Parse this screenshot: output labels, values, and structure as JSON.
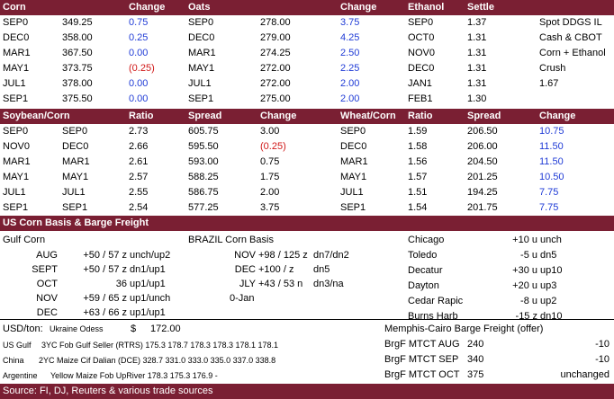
{
  "sec1": {
    "headers": [
      "Corn",
      "Change",
      "Oats",
      "Change",
      "Ethanol",
      "Settle"
    ],
    "rows": [
      {
        "c1": "SEP0",
        "c2": "349.25",
        "c3": "0.75",
        "c3c": "blue",
        "c4": "SEP0",
        "c5": "278.00",
        "c6": "3.75",
        "c6c": "blue",
        "c7": "SEP0",
        "c8": "1.37",
        "c9": "Spot DDGS IL"
      },
      {
        "c1": "DEC0",
        "c2": "358.00",
        "c3": "0.25",
        "c3c": "blue",
        "c4": "DEC0",
        "c5": "279.00",
        "c6": "4.25",
        "c6c": "blue",
        "c7": "OCT0",
        "c8": "1.31",
        "c9": "Cash & CBOT"
      },
      {
        "c1": "MAR1",
        "c2": "367.50",
        "c3": "0.00",
        "c3c": "blue",
        "c4": "MAR1",
        "c5": "274.25",
        "c6": "2.50",
        "c6c": "blue",
        "c7": "NOV0",
        "c8": "1.31",
        "c9": "Corn + Ethanol"
      },
      {
        "c1": "MAY1",
        "c2": "373.75",
        "c3": "(0.25)",
        "c3c": "red",
        "c4": "MAY1",
        "c5": "272.00",
        "c6": "2.25",
        "c6c": "blue",
        "c7": "DEC0",
        "c8": "1.31",
        "c9": "Crush"
      },
      {
        "c1": "JUL1",
        "c2": "378.00",
        "c3": "0.00",
        "c3c": "blue",
        "c4": "JUL1",
        "c5": "272.00",
        "c6": "2.00",
        "c6c": "blue",
        "c7": "JAN1",
        "c8": "1.31",
        "c9": "1.67"
      },
      {
        "c1": "SEP1",
        "c2": "375.50",
        "c3": "0.00",
        "c3c": "blue",
        "c4": "SEP1",
        "c5": "275.00",
        "c6": "2.00",
        "c6c": "blue",
        "c7": "FEB1",
        "c8": "1.30",
        "c9": ""
      }
    ]
  },
  "sec2": {
    "headers": [
      "Soybean/Corn",
      "Ratio",
      "Spread",
      "Change",
      "Wheat/Corn",
      "Ratio",
      "Spread",
      "Change"
    ],
    "rows": [
      {
        "c1": "SEP0",
        "c2": "SEP0",
        "c3": "2.73",
        "c4": "605.75",
        "c5": "3.00",
        "c5c": "black",
        "c6": "SEP0",
        "c7": "1.59",
        "c8": "206.50",
        "c9": "10.75"
      },
      {
        "c1": "NOV0",
        "c2": "DEC0",
        "c3": "2.66",
        "c4": "595.50",
        "c5": "(0.25)",
        "c5c": "red",
        "c6": "DEC0",
        "c7": "1.58",
        "c8": "206.00",
        "c9": "11.50"
      },
      {
        "c1": "MAR1",
        "c2": "MAR1",
        "c3": "2.61",
        "c4": "593.00",
        "c5": "0.75",
        "c5c": "black",
        "c6": "MAR1",
        "c7": "1.56",
        "c8": "204.50",
        "c9": "11.50"
      },
      {
        "c1": "MAY1",
        "c2": "MAY1",
        "c3": "2.57",
        "c4": "588.25",
        "c5": "1.75",
        "c5c": "black",
        "c6": "MAY1",
        "c7": "1.57",
        "c8": "201.25",
        "c9": "10.50"
      },
      {
        "c1": "JUL1",
        "c2": "JUL1",
        "c3": "2.55",
        "c4": "586.75",
        "c5": "2.00",
        "c5c": "black",
        "c6": "JUL1",
        "c7": "1.51",
        "c8": "194.25",
        "c9": "7.75"
      },
      {
        "c1": "SEP1",
        "c2": "SEP1",
        "c3": "2.54",
        "c4": "577.25",
        "c5": "3.75",
        "c5c": "black",
        "c6": "SEP1",
        "c7": "1.54",
        "c8": "201.75",
        "c9": "7.75"
      }
    ]
  },
  "sec3": {
    "title": "US Corn Basis & Barge Freight",
    "gulf_title": "Gulf Corn",
    "brazil_title": "BRAZIL Corn Basis",
    "gulf_rows": [
      {
        "m": "AUG",
        "v": "+50 / 57 z",
        "c": "unch/up2"
      },
      {
        "m": "SEPT",
        "v": "+50 / 57 z",
        "c": "dn1/up1"
      },
      {
        "m": "OCT",
        "v": "36",
        "c": "up1/up1"
      },
      {
        "m": "NOV",
        "v": "+59 / 65 z",
        "c": "up1/unch"
      },
      {
        "m": "DEC",
        "v": "+63 / 66 z",
        "c": "up1/up1"
      }
    ],
    "brazil_rows": [
      {
        "m": "NOV",
        "v": "+98 / 125 z",
        "c": "dn7/dn2"
      },
      {
        "m": "DEC",
        "v": "+100 / z",
        "c": "dn5"
      },
      {
        "m": "JLY",
        "v": "+43 / 53 n",
        "c": "dn3/na"
      },
      {
        "m": "",
        "v": "0-Jan",
        "c": ""
      }
    ],
    "city_rows": [
      {
        "n": "Chicago",
        "v": "+10 u",
        "c": "unch"
      },
      {
        "n": "Toledo",
        "v": "-5 u",
        "c": "dn5"
      },
      {
        "n": "Decatur",
        "v": "+30 u",
        "c": "up10"
      },
      {
        "n": "Dayton",
        "v": "+20 u",
        "c": "up3"
      },
      {
        "n": "Cedar Rapic",
        "v": "-8 u",
        "c": "up2"
      },
      {
        "n": "Burns Harb",
        "v": "-15 z",
        "c": "dn10"
      }
    ]
  },
  "sec4": {
    "usd_label": "USD/ton:",
    "ukr_label": "Ukraine Odess",
    "ukr_cur": "$",
    "ukr_val": "172.00",
    "barge_title": "Memphis-Cairo Barge Freight (offer)",
    "rows": [
      {
        "label": "US Gulf",
        "desc": "3YC Fob Gulf Seller (RTRS) 175.3 178.7 178.3 178.3 178.1 178.1"
      },
      {
        "label": "China",
        "desc": "2YC Maize Cif Dalian (DCE) 328.7 331.0 333.0 335.0 337.0 338.8"
      },
      {
        "label": "Argentine",
        "desc": "Yellow Maize Fob UpRiver  178.3 175.3 176.9  -"
      }
    ],
    "barge_rows": [
      {
        "n": "BrgF MTCT AUG",
        "v": "240",
        "c": "-10"
      },
      {
        "n": "BrgF MTCT SEP",
        "v": "340",
        "c": "-10"
      },
      {
        "n": "BrgF MTCT OCT",
        "v": "375",
        "c": "unchanged"
      }
    ],
    "source": "Source: FI, DJ, Reuters & various trade sources"
  }
}
